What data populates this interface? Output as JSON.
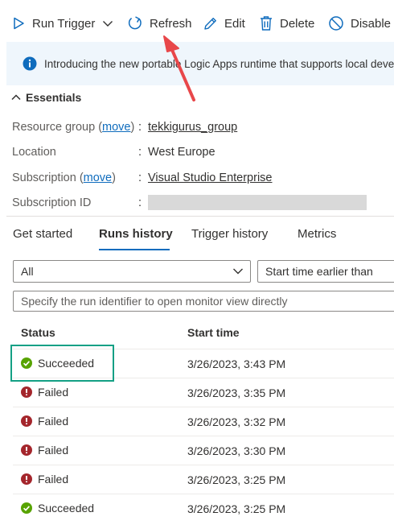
{
  "toolbar": {
    "run_trigger": "Run Trigger",
    "refresh": "Refresh",
    "edit": "Edit",
    "delete": "Delete",
    "disable": "Disable"
  },
  "banner": {
    "text": "Introducing the new portable Logic Apps runtime that supports local development"
  },
  "essentials": {
    "title": "Essentials",
    "resource_group_label": "Resource group",
    "resource_group_move": "move",
    "resource_group_value": "tekkigurus_group",
    "location_label": "Location",
    "location_value": "West Europe",
    "subscription_label": "Subscription",
    "subscription_move": "move",
    "subscription_value": "Visual Studio Enterprise",
    "subscription_id_label": "Subscription ID"
  },
  "tabs": [
    {
      "label": "Get started"
    },
    {
      "label": "Runs history"
    },
    {
      "label": "Trigger history"
    },
    {
      "label": "Metrics"
    }
  ],
  "filters": {
    "status_value": "All",
    "time_value": "Start time earlier than",
    "run_id_placeholder": "Specify the run identifier to open monitor view directly"
  },
  "table": {
    "headers": {
      "status": "Status",
      "start_time": "Start time"
    },
    "rows": [
      {
        "status": "Succeeded",
        "start": "3/26/2023, 3:43 PM"
      },
      {
        "status": "Failed",
        "start": "3/26/2023, 3:35 PM"
      },
      {
        "status": "Failed",
        "start": "3/26/2023, 3:32 PM"
      },
      {
        "status": "Failed",
        "start": "3/26/2023, 3:30 PM"
      },
      {
        "status": "Failed",
        "start": "3/26/2023, 3:25 PM"
      },
      {
        "status": "Succeeded",
        "start": "3/26/2023, 3:25 PM"
      }
    ]
  },
  "colors": {
    "accent": "#0f6cbd",
    "success": "#57a300",
    "failed": "#a4262c",
    "highlight": "#14a085",
    "annotation_arrow": "#e8474a"
  }
}
